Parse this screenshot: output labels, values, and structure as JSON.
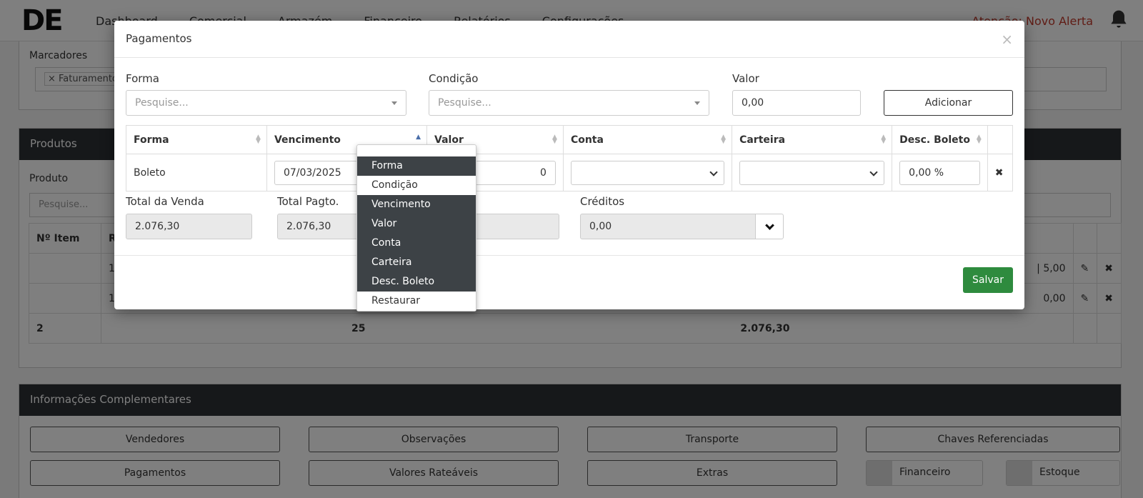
{
  "topbar": {
    "logo": "DE",
    "nav": [
      "Dashboard",
      "Comercial",
      "Armazém",
      "Financeiro",
      "Relatórios",
      "Configurações"
    ],
    "alert": "Atenção: Novo Alerta"
  },
  "background": {
    "marcadores_label": "Marcadores",
    "marcadores_tag": "× Faturamento c",
    "produtos_title": "Produtos",
    "produto_label": "Produto",
    "produto_placeholder": "Pesquise...",
    "table": {
      "col_item": "Nº Item",
      "col_r": "R",
      "rows": [
        {
          "item": "",
          "r": "1",
          "right": "| 5,00"
        },
        {
          "item": "",
          "r": "1",
          "right": "0,00"
        }
      ],
      "total_row": {
        "count": "2",
        "qty": "25",
        "value": "2.076,30"
      }
    },
    "info_title": "Informações Complementares",
    "buttons": [
      "Vendedores",
      "Observações",
      "Transporte",
      "Chaves Referenciadas",
      "Pagamentos",
      "Valores Rateáveis",
      "Extras"
    ],
    "toggles": [
      "Financeiro",
      "Estoque"
    ]
  },
  "modal": {
    "title": "Pagamentos",
    "close": "×",
    "forma_label": "Forma",
    "forma_placeholder": "Pesquise...",
    "condicao_label": "Condição",
    "condicao_placeholder": "Pesquise...",
    "valor_label": "Valor",
    "valor_value": "0,00",
    "add_button": "Adicionar",
    "table": {
      "headers": [
        "Forma",
        "Vencimento",
        "Valor",
        "Conta",
        "Carteira",
        "Desc. Boleto"
      ],
      "row": {
        "forma": "Boleto",
        "vencimento": "07/03/2025",
        "valor": "0",
        "desc_boleto": "0,00 %"
      }
    },
    "total_venda_label": "Total da Venda",
    "total_venda_value": "2.076,30",
    "total_pagto_label": "Total Pagto.",
    "total_pagto_value": "2.076,30",
    "creditos_label": "Créditos",
    "creditos_value": "0,00",
    "save_button": "Salvar"
  },
  "column_menu": {
    "items": [
      {
        "label": "Forma",
        "active": true
      },
      {
        "label": "Condição",
        "active": false
      },
      {
        "label": "Vencimento",
        "active": true
      },
      {
        "label": "Valor",
        "active": true
      },
      {
        "label": "Conta",
        "active": true
      },
      {
        "label": "Carteira",
        "active": true
      },
      {
        "label": "Desc. Boleto",
        "active": true
      },
      {
        "label": "Restaurar",
        "active": false
      }
    ]
  }
}
